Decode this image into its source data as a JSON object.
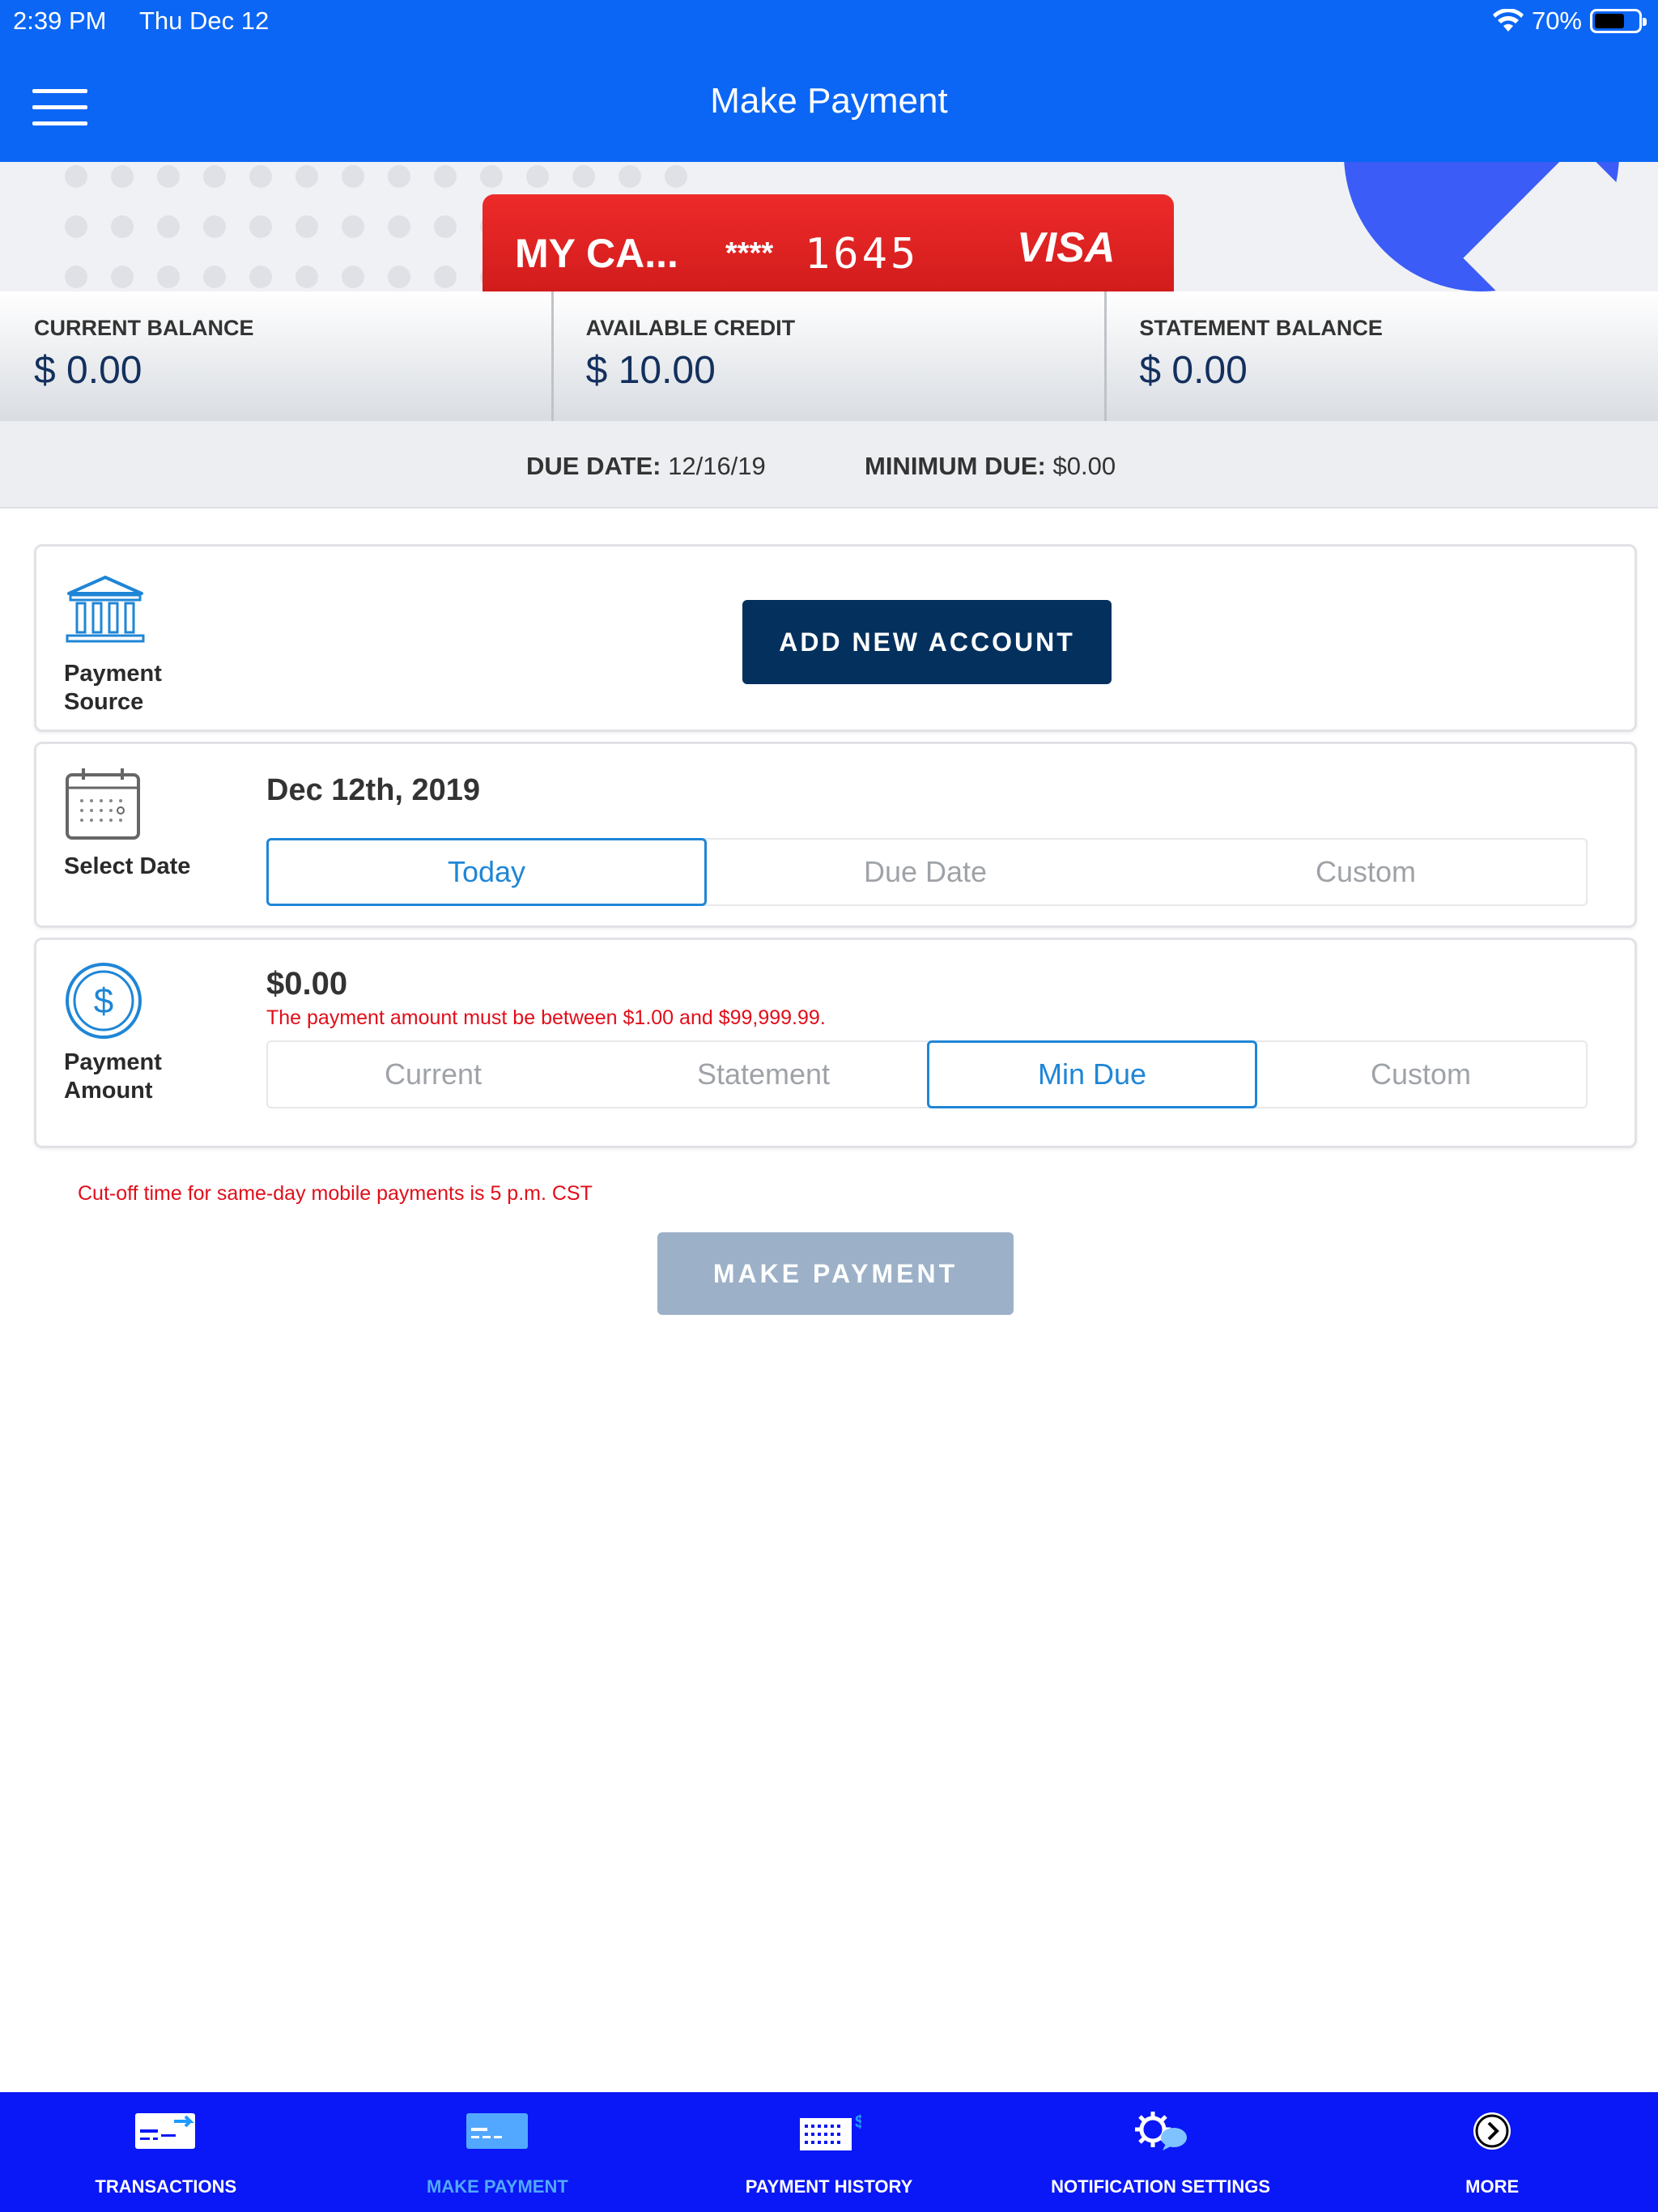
{
  "status": {
    "time": "2:39 PM",
    "day": "Thu Dec 12",
    "battery": "70%",
    "battery_level": 0.7
  },
  "header": {
    "title": "Make Payment"
  },
  "card": {
    "name": "MY CA...",
    "mask": "****",
    "last4": "1645",
    "brand": "VISA"
  },
  "balances": [
    {
      "label": "CURRENT BALANCE",
      "value": "$ 0.00"
    },
    {
      "label": "AVAILABLE CREDIT",
      "value": "$ 10.00"
    },
    {
      "label": "STATEMENT BALANCE",
      "value": "$ 0.00"
    }
  ],
  "due": {
    "date_label": "DUE DATE:",
    "date_value": "12/16/19",
    "min_label": "MINIMUM DUE:",
    "min_value": "$0.00"
  },
  "source": {
    "label_line1": "Payment",
    "label_line2": "Source",
    "add_button": "ADD NEW ACCOUNT"
  },
  "date": {
    "label": "Select Date",
    "value": "Dec 12th, 2019",
    "options": [
      "Today",
      "Due Date",
      "Custom"
    ],
    "selected": "Today"
  },
  "amount": {
    "label_line1": "Payment",
    "label_line2": "Amount",
    "value": "$0.00",
    "error": "The payment amount must be between $1.00 and $99,999.99.",
    "options": [
      "Current",
      "Statement",
      "Min Due",
      "Custom"
    ],
    "selected": "Min Due"
  },
  "cutoff_note": "Cut-off time for same-day mobile payments is 5 p.m. CST",
  "make_payment_button": "MAKE PAYMENT",
  "tabs": [
    {
      "label": "TRANSACTIONS",
      "icon": "transactions-icon"
    },
    {
      "label": "MAKE PAYMENT",
      "icon": "card-icon"
    },
    {
      "label": "PAYMENT HISTORY",
      "icon": "calendar-dollar-icon"
    },
    {
      "label": "NOTIFICATION SETTINGS",
      "icon": "gear-chat-icon"
    },
    {
      "label": "MORE",
      "icon": "chevron-right-circle-icon"
    }
  ],
  "active_tab": "MAKE PAYMENT",
  "colors": {
    "nav": "#0b66f5",
    "tabbar": "#0a17f6",
    "card": "#e02020",
    "primary_button": "#04305e",
    "error": "#e10e1a",
    "accent": "#1f86d6"
  }
}
